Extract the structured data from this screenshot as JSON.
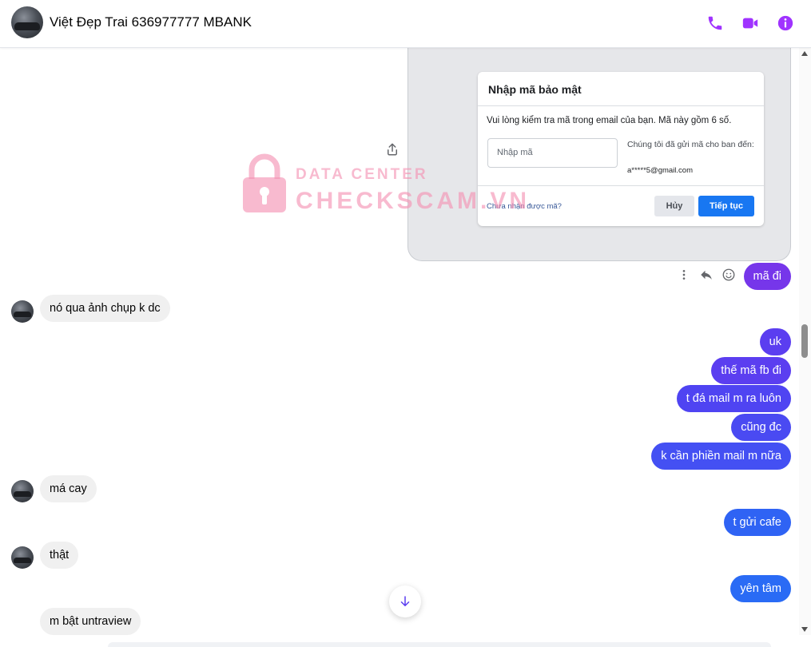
{
  "header": {
    "contact_name": "Việt Đẹp Trai 636977777 MBANK",
    "icons": [
      "phone-icon",
      "video-call-icon",
      "info-icon"
    ],
    "accent_color": "#a033ff"
  },
  "screenshot_dialog": {
    "title": "Nhập mã bảo mật",
    "message": "Vui lòng kiểm tra mã trong email của bạn. Mã này gồm 6 số.",
    "input_placeholder": "Nhập mã",
    "sent_to_text": "Chúng tôi đã gửi mã cho ban đến:",
    "email": "a*****5@gmail.com",
    "resend_link": "Chưa nhận được mã?",
    "cancel_label": "Hủy",
    "continue_label": "Tiếp tục"
  },
  "watermark": {
    "line1": "DATA CENTER",
    "line2": "CHECKSCAM.VN"
  },
  "messages": [
    {
      "side": "out",
      "text": "mã đi",
      "color": "#7636ea"
    },
    {
      "side": "in",
      "text": "nó qua ảnh chụp k dc"
    },
    {
      "side": "out",
      "text": "uk",
      "color": "#5b3ef0"
    },
    {
      "side": "out",
      "text": "thế mã fb đi",
      "color": "#5b3ef0"
    },
    {
      "side": "out",
      "text": "t đá mail m ra luôn",
      "color": "#4f44f2"
    },
    {
      "side": "out",
      "text": "cũng đc",
      "color": "#4a4af2"
    },
    {
      "side": "out",
      "text": "k cần phiền mail m nữa",
      "color": "#4450f3"
    },
    {
      "side": "in",
      "text": "má cay"
    },
    {
      "side": "out",
      "text": "t gửi cafe",
      "color": "#2f63f4"
    },
    {
      "side": "in",
      "text": "thật"
    },
    {
      "side": "out",
      "text": "yên tâm",
      "color": "#2a6bf5"
    },
    {
      "side": "in",
      "text": "m bật untraview"
    }
  ],
  "message_actions": [
    "more-options-icon",
    "reply-icon",
    "emoji-react-icon"
  ]
}
